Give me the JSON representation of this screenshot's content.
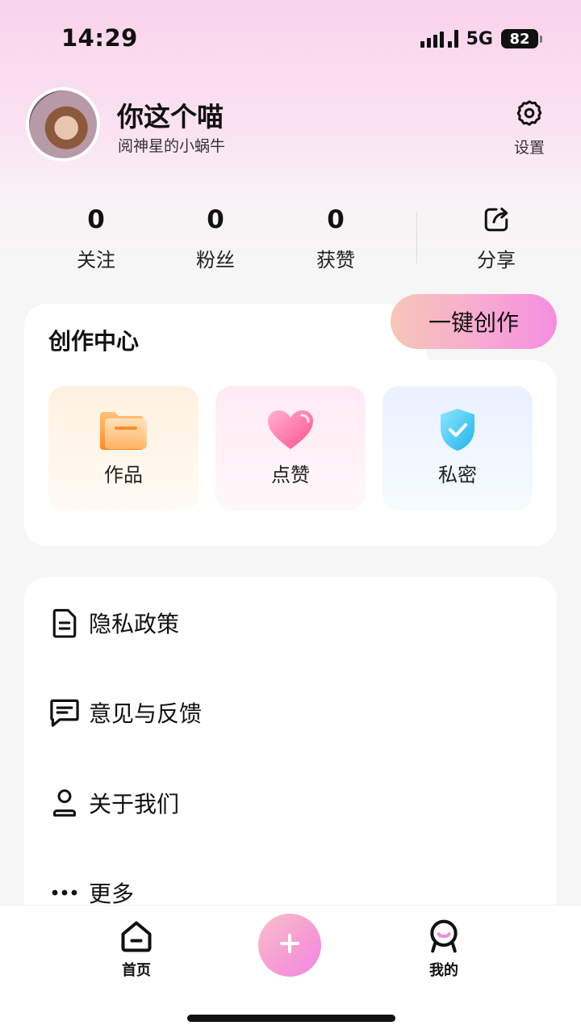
{
  "status_bar": {
    "time": "14:29",
    "network": "5G",
    "battery": "82"
  },
  "profile": {
    "name": "你这个喵",
    "subtitle": "阅神星的小蜗牛",
    "settings_label": "设置"
  },
  "stats": [
    {
      "value": "0",
      "label": "关注"
    },
    {
      "value": "0",
      "label": "粉丝"
    },
    {
      "value": "0",
      "label": "获赞"
    }
  ],
  "share_label": "分享",
  "creation": {
    "title": "创作中心",
    "button_label": "一键创作",
    "tiles": [
      {
        "label": "作品",
        "icon": "folder-icon"
      },
      {
        "label": "点赞",
        "icon": "heart-icon"
      },
      {
        "label": "私密",
        "icon": "shield-check-icon"
      }
    ]
  },
  "menu": [
    {
      "label": "隐私政策",
      "icon": "document-icon"
    },
    {
      "label": "意见与反馈",
      "icon": "message-icon"
    },
    {
      "label": "关于我们",
      "icon": "person-icon"
    },
    {
      "label": "更多",
      "icon": "more-dots-icon"
    }
  ],
  "bottom_nav": {
    "home_label": "首页",
    "mine_label": "我的"
  },
  "colors": {
    "accent_pink": "#f69ad6",
    "header_pink": "#f9d3ec"
  }
}
